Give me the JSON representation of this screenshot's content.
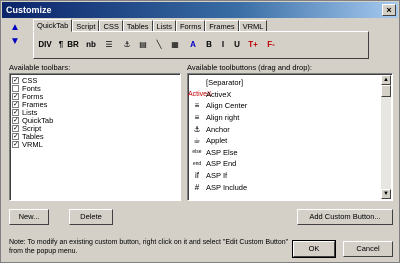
{
  "window": {
    "title": "Customize",
    "close": "×"
  },
  "arrows": {
    "up": "▲",
    "down": "▼"
  },
  "tabs": [
    "QuickTab",
    "Script",
    "CSS",
    "Tables",
    "Lists",
    "Forms",
    "Frames",
    "VRML"
  ],
  "toolbar_buttons": [
    {
      "label": "DIV"
    },
    {
      "label": "¶"
    },
    {
      "label": "BR"
    },
    {
      "label": "nb"
    },
    {
      "label": "☰"
    },
    {
      "label": "⚓"
    },
    {
      "label": "▤"
    },
    {
      "label": "╲"
    },
    {
      "label": "▦"
    },
    {
      "label": "A"
    },
    {
      "label": "B"
    },
    {
      "label": "I"
    },
    {
      "label": "U"
    },
    {
      "label": "T+"
    },
    {
      "label": "F-"
    }
  ],
  "left": {
    "label": "Available toolbars:",
    "items": [
      {
        "name": "CSS",
        "checked": true
      },
      {
        "name": "Fonts",
        "checked": false
      },
      {
        "name": "Forms",
        "checked": true
      },
      {
        "name": "Frames",
        "checked": true
      },
      {
        "name": "Lists",
        "checked": true
      },
      {
        "name": "QuickTab",
        "checked": true
      },
      {
        "name": "Script",
        "checked": true
      },
      {
        "name": "Tables",
        "checked": true
      },
      {
        "name": "VRML",
        "checked": true
      }
    ]
  },
  "right": {
    "label": "Available toolbuttons (drag and drop):",
    "items": [
      {
        "icon": "",
        "name": "[Separator]"
      },
      {
        "icon": "ActiveX",
        "name": "ActiveX"
      },
      {
        "icon": "≡",
        "name": "Align Center"
      },
      {
        "icon": "≡",
        "name": "Align right"
      },
      {
        "icon": "⚓",
        "name": "Anchor"
      },
      {
        "icon": "☕",
        "name": "Applet"
      },
      {
        "icon": "else",
        "name": "ASP Else"
      },
      {
        "icon": "end",
        "name": "ASP End"
      },
      {
        "icon": "if",
        "name": "ASP If"
      },
      {
        "icon": "#",
        "name": "ASP Include"
      }
    ]
  },
  "buttons": {
    "new": "New...",
    "delete": "Delete",
    "add_custom": "Add Custom Button...",
    "ok": "OK",
    "cancel": "Cancel"
  },
  "note": "Note: To modify an existing custom button, right click on it and select \"Edit Custom Button\" from the popup menu."
}
